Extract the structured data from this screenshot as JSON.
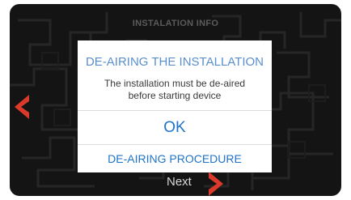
{
  "header": {
    "title": "INSTALATION INFO"
  },
  "dialog": {
    "title": "DE-AIRING THE INSTALLATION",
    "message_line1": "The installation must be de-aired",
    "message_line2": "before starting device",
    "ok_label": "OK",
    "procedure_label": "DE-AIRING PROCEDURE"
  },
  "navigation": {
    "next_label": "Next",
    "prev_icon": "chevron-left-icon",
    "next_icon": "chevron-right-icon"
  },
  "colors": {
    "background": "#141414",
    "accent_arrow": "#d93a2b",
    "dialog_title": "#5a8fcd",
    "dialog_button": "#1f73c8"
  }
}
